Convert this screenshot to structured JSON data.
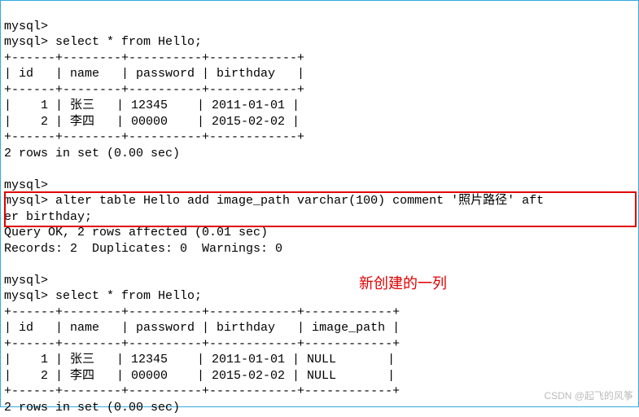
{
  "prompt": "mysql>",
  "cmd1": "mysql> select * from Hello;",
  "table1": {
    "border": "+------+--------+----------+------------+",
    "header": "| id   | name   | password | birthday   |",
    "row1": "|    1 | 张三   | 12345    | 2011-01-01 |",
    "row2": "|    2 | 李四   | 00000    | 2015-02-02 |"
  },
  "result1": "2 rows in set (0.00 sec)",
  "alter_cmd_line1": "mysql> alter table Hello add image_path varchar(100) comment '照片路径' aft",
  "alter_cmd_line2": "er birthday;",
  "query_ok": "Query OK, 2 rows affected (0.01 sec)",
  "records": "Records: 2  Duplicates: 0  Warnings: 0",
  "cmd2": "mysql> select * from Hello;",
  "table2": {
    "border": "+------+--------+----------+------------+------------+",
    "header": "| id   | name   | password | birthday   | image_path |",
    "row1": "|    1 | 张三   | 12345    | 2011-01-01 | NULL       |",
    "row2": "|    2 | 李四   | 00000    | 2015-02-02 | NULL       |"
  },
  "result2": "2 rows in set (0.00 sec)",
  "annotation": "新创建的一列",
  "watermark": "CSDN @起飞的风筝",
  "chart_data": {
    "type": "table",
    "tables": [
      {
        "title": "Hello (before alter)",
        "columns": [
          "id",
          "name",
          "password",
          "birthday"
        ],
        "rows": [
          [
            1,
            "张三",
            "12345",
            "2011-01-01"
          ],
          [
            2,
            "李四",
            "00000",
            "2015-02-02"
          ]
        ]
      },
      {
        "title": "Hello (after alter)",
        "columns": [
          "id",
          "name",
          "password",
          "birthday",
          "image_path"
        ],
        "rows": [
          [
            1,
            "张三",
            "12345",
            "2011-01-01",
            "NULL"
          ],
          [
            2,
            "李四",
            "00000",
            "2015-02-02",
            "NULL"
          ]
        ]
      }
    ],
    "alter_statement": "alter table Hello add image_path varchar(100) comment '照片路径' after birthday;"
  }
}
